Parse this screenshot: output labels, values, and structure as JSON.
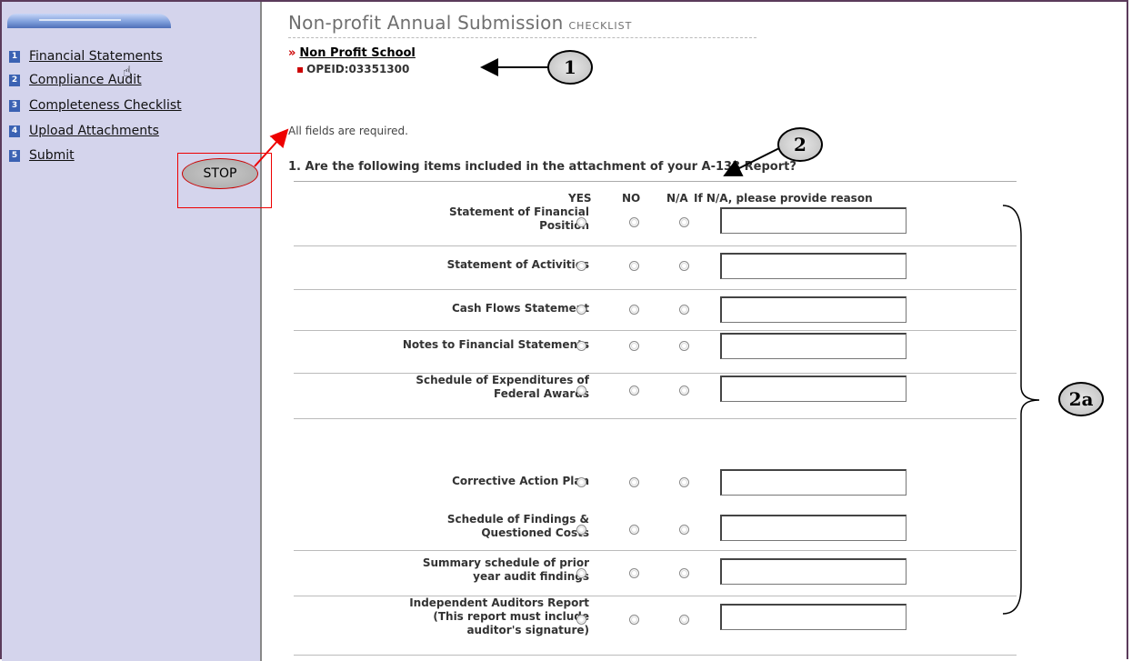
{
  "sidebar": {
    "items": [
      {
        "num": "1",
        "label": "Financial Statements"
      },
      {
        "num": "2",
        "label": "Compliance Audit"
      },
      {
        "num": "3",
        "label": "Completeness Checklist"
      },
      {
        "num": "4",
        "label": "Upload Attachments"
      },
      {
        "num": "5",
        "label": "Submit"
      }
    ]
  },
  "header": {
    "title": "Non-profit Annual Submission",
    "subtitle": "CHECKLIST",
    "school_chevron": "»",
    "school_name": "Non Profit School",
    "opeid_bullet": "▪",
    "opeid": "OPEID:03351300"
  },
  "form": {
    "required_note": "All fields are required.",
    "question": "1. Are the following items included in the attachment of your A-133 Report?",
    "columns": {
      "yes": "YES",
      "no": "NO",
      "na": "N/A",
      "reason": "If N/A, please provide reason"
    },
    "rows": [
      {
        "label_lines": [
          "Statement of Financial",
          "Position"
        ],
        "reason": ""
      },
      {
        "label_lines": [
          "Statement of Activities"
        ],
        "reason": ""
      },
      {
        "label_lines": [
          "Cash Flows Statement"
        ],
        "reason": ""
      },
      {
        "label_lines": [
          "Notes to Financial Statements"
        ],
        "reason": ""
      },
      {
        "label_lines": [
          "Schedule of Expenditures of",
          "Federal Awards"
        ],
        "reason": ""
      },
      {
        "label_lines": [
          "Corrective Action Plan"
        ],
        "reason": ""
      },
      {
        "label_lines": [
          "Schedule of Findings &",
          "Questioned Costs"
        ],
        "reason": ""
      },
      {
        "label_lines": [
          "Summary schedule of prior",
          "year audit findings"
        ],
        "reason": ""
      },
      {
        "label_lines": [
          "Independent Auditors Report",
          "(This report must include",
          "auditor's signature)"
        ],
        "reason": ""
      }
    ]
  },
  "annotations": {
    "callout_1": "1",
    "callout_2": "2",
    "callout_2a": "2a",
    "stop": "STOP"
  },
  "colors": {
    "sidebar_bg": "#d4d4ec",
    "nav_number_bg": "#3b62b3",
    "accent_red": "#cc0000"
  }
}
